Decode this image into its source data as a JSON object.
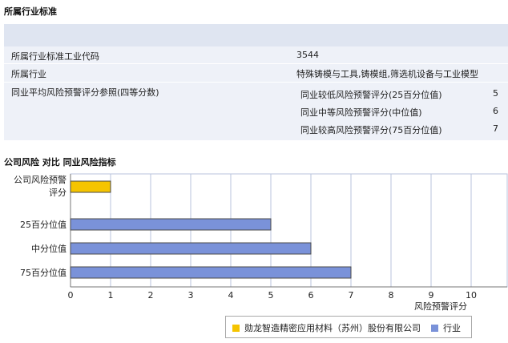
{
  "section1": {
    "title": "所属行业标准"
  },
  "table": {
    "rows": [
      {
        "label": "所属行业标准工业代码",
        "value": "3544"
      },
      {
        "label": "所属行业",
        "value": "特殊铸模与工具,铸模组,筛选机设备与工业模型"
      },
      {
        "label": "同业平均风险预警评分参照(四等分数)"
      }
    ],
    "quartiles": [
      {
        "label": "同业较低风险预警评分(25百分位值)",
        "value": "5"
      },
      {
        "label": "同业中等风险预警评分(中位值)",
        "value": "6"
      },
      {
        "label": "同业较高风险预警评分(75百分位值)",
        "value": "7"
      }
    ]
  },
  "section2": {
    "title": "公司风险 对比 同业风险指标"
  },
  "chart_data": {
    "type": "bar",
    "orientation": "horizontal",
    "categories": [
      "公司风险预警评分",
      "25百分位值",
      "中分位值",
      "75百分位值"
    ],
    "category_lines": [
      [
        "公司风险预警",
        "评分"
      ],
      [
        "25百分位值"
      ],
      [
        "中分位值"
      ],
      [
        "75百分位值"
      ]
    ],
    "series": [
      {
        "name": "勋龙智造精密应用材料（苏州）股份有限公司",
        "color": "#f5c400",
        "values": [
          1,
          null,
          null,
          null
        ]
      },
      {
        "name": "行业",
        "color": "#7a92d9",
        "values": [
          null,
          5,
          6,
          7
        ]
      }
    ],
    "xlim": [
      0,
      10
    ],
    "xticks": [
      "0",
      "1",
      "2",
      "3",
      "4",
      "5",
      "6",
      "7",
      "8",
      "9",
      "10"
    ],
    "xlabel": "风险预警评分",
    "grid": true,
    "legend": "bottom"
  }
}
